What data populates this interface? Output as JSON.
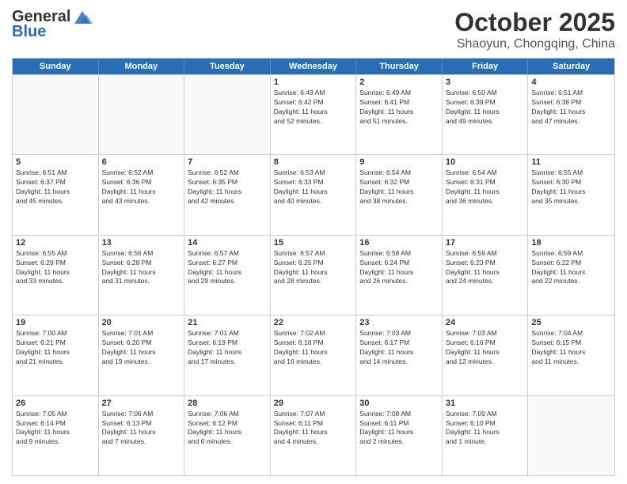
{
  "header": {
    "logo_general": "General",
    "logo_blue": "Blue",
    "month_title": "October 2025",
    "subtitle": "Shaoyun, Chongqing, China"
  },
  "weekdays": [
    "Sunday",
    "Monday",
    "Tuesday",
    "Wednesday",
    "Thursday",
    "Friday",
    "Saturday"
  ],
  "weeks": [
    [
      {
        "day": "",
        "info": ""
      },
      {
        "day": "",
        "info": ""
      },
      {
        "day": "",
        "info": ""
      },
      {
        "day": "1",
        "info": "Sunrise: 6:49 AM\nSunset: 6:42 PM\nDaylight: 11 hours\nand 52 minutes."
      },
      {
        "day": "2",
        "info": "Sunrise: 6:49 AM\nSunset: 6:41 PM\nDaylight: 11 hours\nand 51 minutes."
      },
      {
        "day": "3",
        "info": "Sunrise: 6:50 AM\nSunset: 6:39 PM\nDaylight: 11 hours\nand 49 minutes."
      },
      {
        "day": "4",
        "info": "Sunrise: 6:51 AM\nSunset: 6:38 PM\nDaylight: 11 hours\nand 47 minutes."
      }
    ],
    [
      {
        "day": "5",
        "info": "Sunrise: 6:51 AM\nSunset: 6:37 PM\nDaylight: 11 hours\nand 45 minutes."
      },
      {
        "day": "6",
        "info": "Sunrise: 6:52 AM\nSunset: 6:36 PM\nDaylight: 11 hours\nand 43 minutes."
      },
      {
        "day": "7",
        "info": "Sunrise: 6:52 AM\nSunset: 6:35 PM\nDaylight: 11 hours\nand 42 minutes."
      },
      {
        "day": "8",
        "info": "Sunrise: 6:53 AM\nSunset: 6:33 PM\nDaylight: 11 hours\nand 40 minutes."
      },
      {
        "day": "9",
        "info": "Sunrise: 6:54 AM\nSunset: 6:32 PM\nDaylight: 11 hours\nand 38 minutes."
      },
      {
        "day": "10",
        "info": "Sunrise: 6:54 AM\nSunset: 6:31 PM\nDaylight: 11 hours\nand 36 minutes."
      },
      {
        "day": "11",
        "info": "Sunrise: 6:55 AM\nSunset: 6:30 PM\nDaylight: 11 hours\nand 35 minutes."
      }
    ],
    [
      {
        "day": "12",
        "info": "Sunrise: 6:55 AM\nSunset: 6:29 PM\nDaylight: 11 hours\nand 33 minutes."
      },
      {
        "day": "13",
        "info": "Sunrise: 6:56 AM\nSunset: 6:28 PM\nDaylight: 11 hours\nand 31 minutes."
      },
      {
        "day": "14",
        "info": "Sunrise: 6:57 AM\nSunset: 6:27 PM\nDaylight: 11 hours\nand 29 minutes."
      },
      {
        "day": "15",
        "info": "Sunrise: 6:57 AM\nSunset: 6:25 PM\nDaylight: 11 hours\nand 28 minutes."
      },
      {
        "day": "16",
        "info": "Sunrise: 6:58 AM\nSunset: 6:24 PM\nDaylight: 11 hours\nand 26 minutes."
      },
      {
        "day": "17",
        "info": "Sunrise: 6:59 AM\nSunset: 6:23 PM\nDaylight: 11 hours\nand 24 minutes."
      },
      {
        "day": "18",
        "info": "Sunrise: 6:59 AM\nSunset: 6:22 PM\nDaylight: 11 hours\nand 22 minutes."
      }
    ],
    [
      {
        "day": "19",
        "info": "Sunrise: 7:00 AM\nSunset: 6:21 PM\nDaylight: 11 hours\nand 21 minutes."
      },
      {
        "day": "20",
        "info": "Sunrise: 7:01 AM\nSunset: 6:20 PM\nDaylight: 11 hours\nand 19 minutes."
      },
      {
        "day": "21",
        "info": "Sunrise: 7:01 AM\nSunset: 6:19 PM\nDaylight: 11 hours\nand 17 minutes."
      },
      {
        "day": "22",
        "info": "Sunrise: 7:02 AM\nSunset: 6:18 PM\nDaylight: 11 hours\nand 16 minutes."
      },
      {
        "day": "23",
        "info": "Sunrise: 7:03 AM\nSunset: 6:17 PM\nDaylight: 11 hours\nand 14 minutes."
      },
      {
        "day": "24",
        "info": "Sunrise: 7:03 AM\nSunset: 6:16 PM\nDaylight: 11 hours\nand 12 minutes."
      },
      {
        "day": "25",
        "info": "Sunrise: 7:04 AM\nSunset: 6:15 PM\nDaylight: 11 hours\nand 11 minutes."
      }
    ],
    [
      {
        "day": "26",
        "info": "Sunrise: 7:05 AM\nSunset: 6:14 PM\nDaylight: 11 hours\nand 9 minutes."
      },
      {
        "day": "27",
        "info": "Sunrise: 7:06 AM\nSunset: 6:13 PM\nDaylight: 11 hours\nand 7 minutes."
      },
      {
        "day": "28",
        "info": "Sunrise: 7:06 AM\nSunset: 6:12 PM\nDaylight: 11 hours\nand 6 minutes."
      },
      {
        "day": "29",
        "info": "Sunrise: 7:07 AM\nSunset: 6:11 PM\nDaylight: 11 hours\nand 4 minutes."
      },
      {
        "day": "30",
        "info": "Sunrise: 7:08 AM\nSunset: 6:11 PM\nDaylight: 11 hours\nand 2 minutes."
      },
      {
        "day": "31",
        "info": "Sunrise: 7:09 AM\nSunset: 6:10 PM\nDaylight: 11 hours\nand 1 minute."
      },
      {
        "day": "",
        "info": ""
      }
    ]
  ]
}
